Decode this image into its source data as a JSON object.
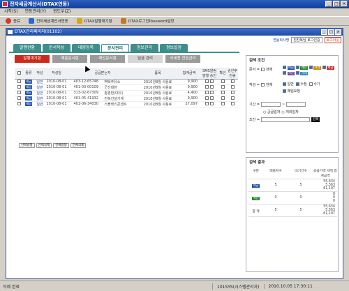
{
  "window": {
    "title": "전자세금계산서(DTAX연동)"
  },
  "menu": [
    "시작(S)",
    "연동관리(Y)",
    "윈도우(Z)"
  ],
  "toolbar": [
    {
      "label": "종료",
      "color": "#d23a2a"
    },
    {
      "label": "전자세금계산서연동",
      "color": "#2a6ad0"
    },
    {
      "label": "DTAX발행대기함",
      "color": "#e0a020"
    },
    {
      "label": "DTAX로그인Password설정",
      "color": "#c07a20"
    }
  ],
  "child": {
    "title": "DTAX관리페이지(01102)",
    "user_label": "연동회사명",
    "user_value": "진찬복님 로그인중",
    "logout": "로그아웃"
  },
  "tabs1": [
    {
      "label": "발행현황",
      "active": false
    },
    {
      "label": "문서작성",
      "active": false
    },
    {
      "label": "대량등록",
      "active": false
    },
    {
      "label": "문서관리",
      "active": true
    },
    {
      "label": "정보관리",
      "active": false
    },
    {
      "label": "정보설정",
      "active": false
    }
  ],
  "tabs2": [
    {
      "label": "발행대기함",
      "state": "active"
    },
    {
      "label": "매출문서함",
      "state": ""
    },
    {
      "label": "매입문서함",
      "state": ""
    },
    {
      "label": "임금 관리",
      "state": "light"
    },
    {
      "label": "국세청 전송관리",
      "state": ""
    }
  ],
  "grid": {
    "headers": [
      "종류",
      "작성",
      "작성일",
      "공급받는자",
      "품목",
      "합계금액",
      "SMS알림",
      "확인",
      "승인후",
      "전송"
    ],
    "sms_sub": [
      "발행",
      "승인"
    ],
    "rows": [
      {
        "kind": "세금",
        "type": "일반",
        "date": "2010-08-01",
        "bizno": "403-12-65748",
        "name": "벡텍주유소",
        "item": "2010년8월 사용료",
        "amount": "9,900"
      },
      {
        "kind": "세금",
        "type": "일반",
        "date": "2010-08-01",
        "bizno": "401-03-00109",
        "name": "군산대현",
        "item": "2010년8월 사용료",
        "amount": "9,900"
      },
      {
        "kind": "세금",
        "type": "일반",
        "date": "2010-08-01",
        "bizno": "313-02-67309",
        "name": "평경환(대우)",
        "item": "2010년8월 사용료",
        "amount": "4,400"
      },
      {
        "kind": "세금",
        "type": "일반",
        "date": "2010-08-01",
        "bizno": "401-05-41932",
        "name": "전북건설기계",
        "item": "2010년8월 사용료",
        "amount": "9,900"
      },
      {
        "kind": "세금",
        "type": "일반",
        "date": "2010-08-01",
        "bizno": "401-06-34030",
        "name": "스플랙스콘센트",
        "item": "2010년8월 사용료",
        "amount": "27,097"
      }
    ],
    "buttons": [
      "선택발행",
      "선택삭제",
      "전체발행",
      "전체삭제"
    ]
  },
  "search": {
    "title": "검색 조건",
    "doc_label": "문서 =",
    "all": "전체",
    "doc_chips": [
      {
        "label": "세금",
        "color": "#1c4fa8"
      },
      {
        "label": "계산",
        "color": "#2a8a2a"
      },
      {
        "label": "거래",
        "color": "#c98a10"
      },
      {
        "label": "세금",
        "color": "#c03030"
      },
      {
        "label": "계산",
        "color": "#6a40a0"
      },
      {
        "label": "거래",
        "color": "#2a90b0"
      }
    ],
    "write_label": "작성 =",
    "write_opts": [
      "일반",
      "수정",
      "수기",
      "매입요청"
    ],
    "period_label": "기간 =",
    "period_opts": [
      "공급일자",
      "처리일자"
    ],
    "cond_label": "조건 =",
    "search_btn": "검색"
  },
  "result": {
    "title": "검색 결과",
    "headers": [
      "구분",
      "매출처수",
      "대기건수",
      "공급가액 세액 합계금액"
    ],
    "rows": [
      {
        "chip": "세금",
        "color": "#1c4fa8",
        "c1": "5",
        "c2": "5",
        "v": [
          "55,634",
          "5,563",
          "61,197"
        ]
      },
      {
        "chip": "계산",
        "color": "#2a8a2a",
        "c1": "0",
        "c2": "0",
        "v": [
          "0",
          "0",
          "0"
        ]
      },
      {
        "chip": "합 계",
        "color": "",
        "c1": "5",
        "c2": "5",
        "v": [
          "55,634",
          "5,563",
          "61,197"
        ]
      }
    ]
  },
  "status": {
    "left": "삭제 완료",
    "user": "101SYS(시스템관리자)",
    "time": "2010.10.05 17:30:11"
  }
}
